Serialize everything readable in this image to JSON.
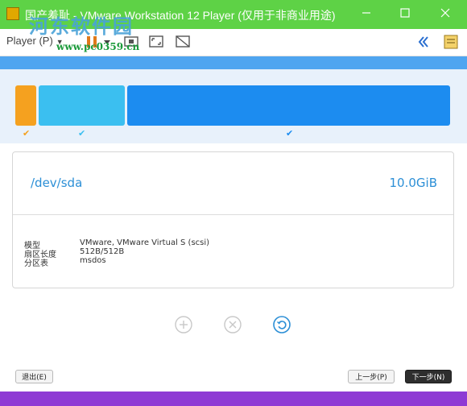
{
  "window": {
    "title": "国产羞耻 - VMware Workstation 12 Player (仅用于非商业用途)",
    "minimize_icon": "minimize-icon",
    "maximize_icon": "maximize-icon",
    "close_icon": "close-icon"
  },
  "toolbar": {
    "player_menu": "Player (P)"
  },
  "watermark": {
    "text": "河东软件园",
    "url": "www.pc0359.cn"
  },
  "partition_map": {
    "colors": {
      "seg1": "#f5a11f",
      "seg2": "#3bbff0",
      "seg3": "#1c8cf0"
    },
    "checks": [
      "✔",
      "✔",
      "✔"
    ]
  },
  "disk": {
    "device": "/dev/sda",
    "size": "10.0GiB",
    "labels": {
      "model": "模型",
      "sector": "扇区长度",
      "table": "分区表"
    },
    "values": {
      "model": "VMware, VMware Virtual S (scsi)",
      "sector": "512B/512B",
      "table": "msdos"
    }
  },
  "buttons": {
    "quit": "退出(E)",
    "back": "上一步(P)",
    "next": "下一步(N)"
  },
  "colors": {
    "titlebar": "#5ed246",
    "accent": "#2c8fd6",
    "bottom_strip": "#8e3ad4"
  }
}
